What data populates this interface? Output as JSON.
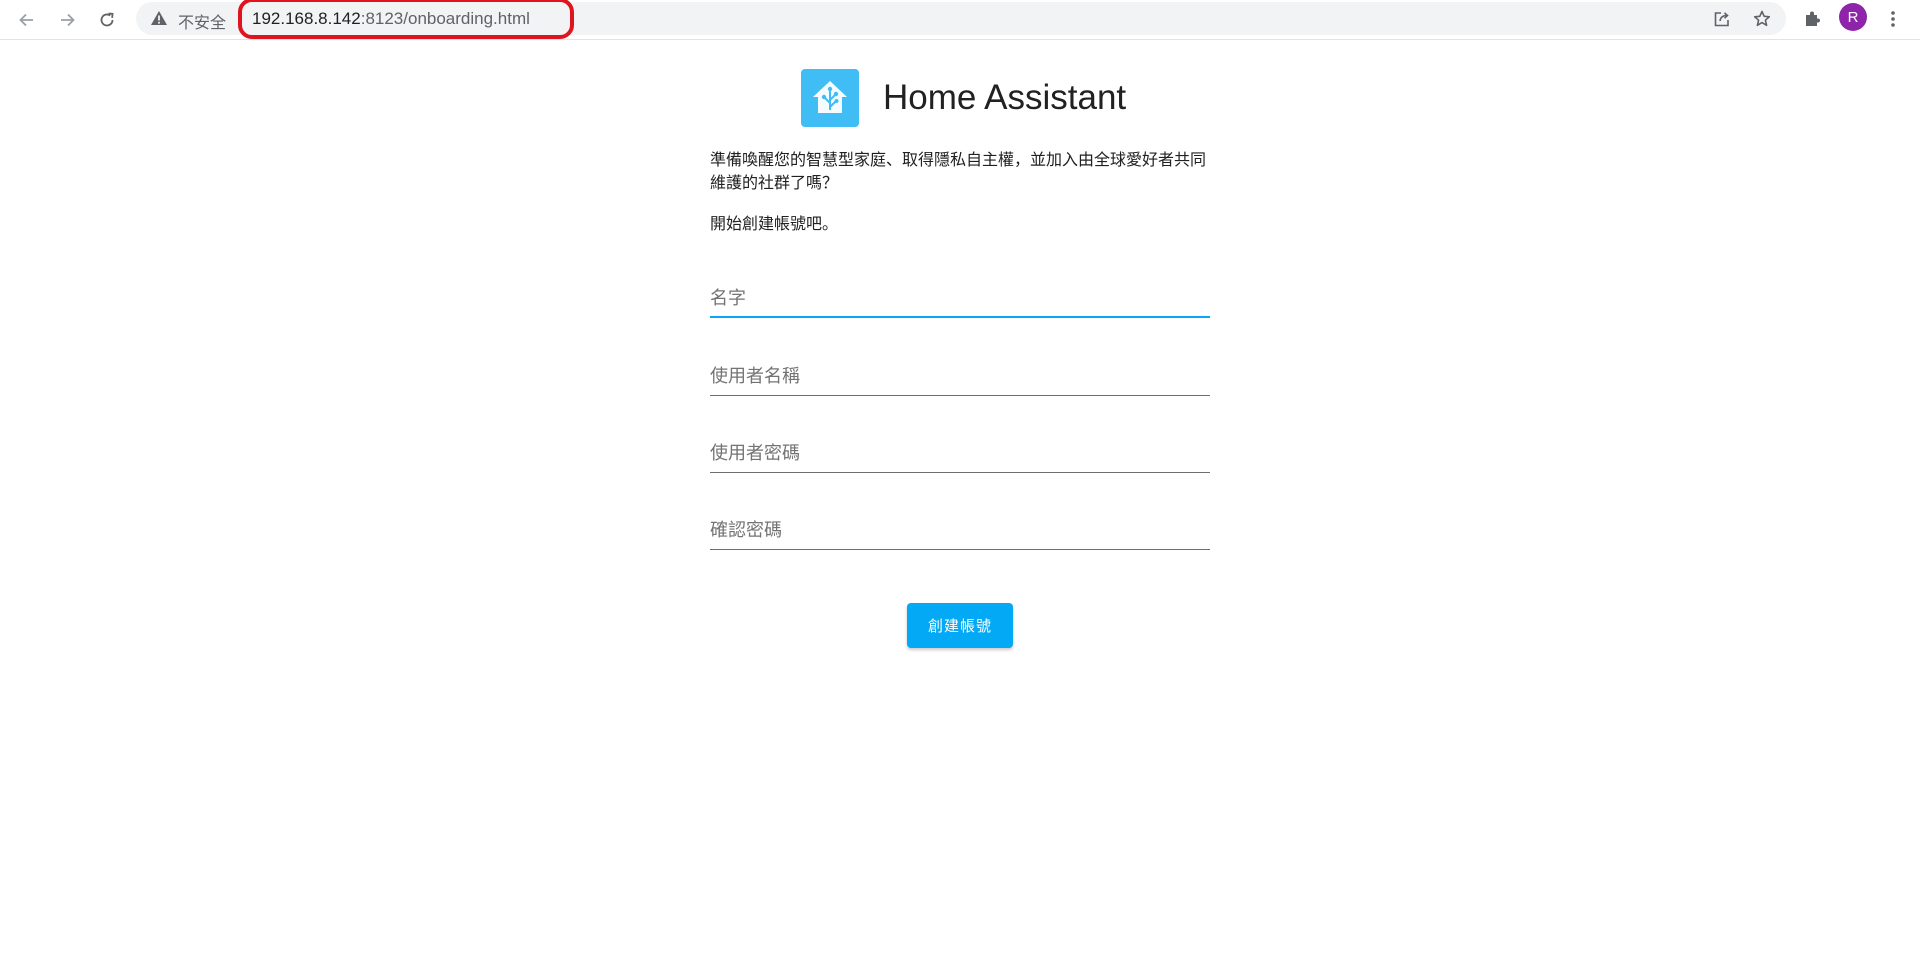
{
  "browser": {
    "security_label": "不安全",
    "url_host": "192.168.8.142",
    "url_rest": ":8123/onboarding.html",
    "profile_initial": "R",
    "profile_color": "#8e24aa",
    "highlight_color": "#e0141e",
    "icons": {
      "back": "arrow-left-icon",
      "forward": "arrow-right-icon",
      "reload": "reload-icon",
      "warning": "warning-triangle-icon",
      "share": "share-icon",
      "bookmark": "star-icon",
      "extensions": "puzzle-icon",
      "menu": "kebab-menu-icon"
    }
  },
  "page": {
    "app_title": "Home Assistant",
    "logo_icon": "home-assistant-logo-icon",
    "logo_color": "#41bdf5",
    "intro_text": "準備喚醒您的智慧型家庭、取得隱私自主權，並加入由全球愛好者共同維護的社群了嗎？",
    "intro_text_2": "開始創建帳號吧。",
    "form": {
      "name_placeholder": "名字",
      "username_placeholder": "使用者名稱",
      "password_placeholder": "使用者密碼",
      "confirm_password_placeholder": "確認密碼",
      "submit_label": "創建帳號",
      "accent_color": "#03a9f4"
    }
  }
}
